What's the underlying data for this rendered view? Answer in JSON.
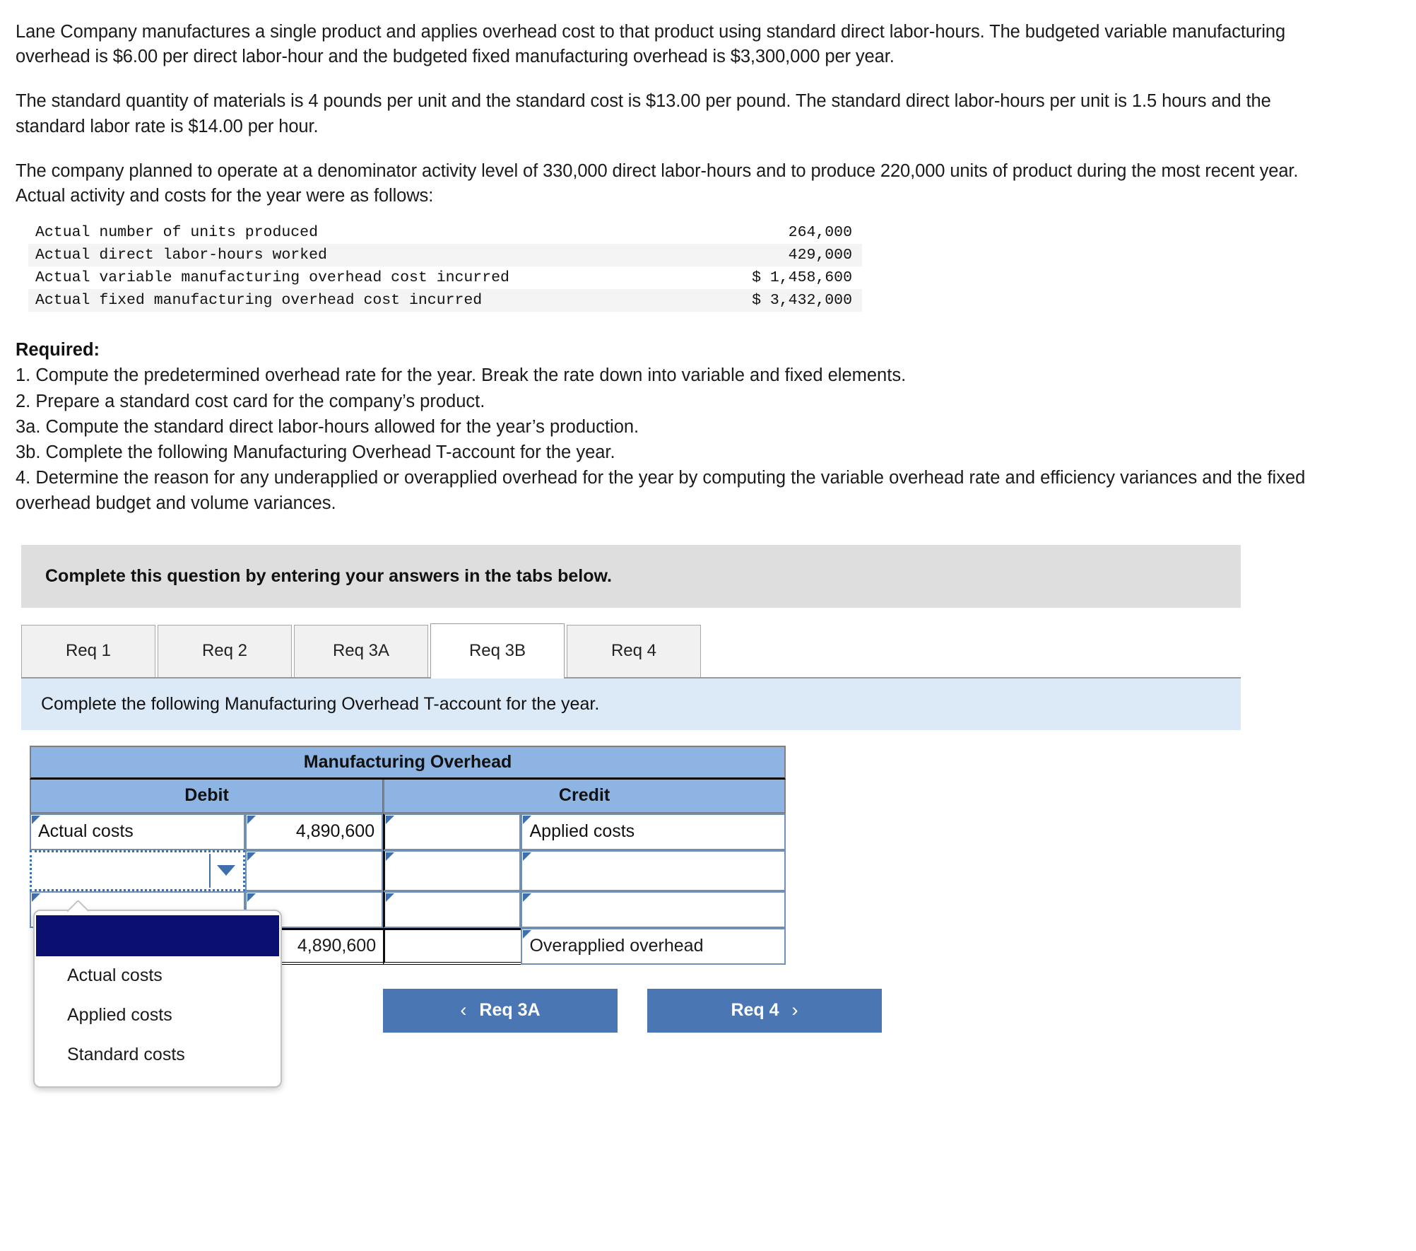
{
  "problem": {
    "paragraphs": [
      "Lane Company manufactures a single product and applies overhead cost to that product using standard direct labor-hours. The budgeted variable manufacturing overhead is $6.00 per direct labor-hour and the budgeted fixed manufacturing overhead is $3,300,000 per year.",
      "The standard quantity of materials is 4 pounds per unit and the standard cost is $13.00 per pound. The standard direct labor-hours per unit is 1.5 hours and the standard labor rate is $14.00 per hour.",
      "The company planned to operate at a denominator activity level of 330,000 direct labor-hours and to produce 220,000 units of product during the most recent year. Actual activity and costs for the year were as follows:"
    ]
  },
  "facts_table": {
    "rows": [
      {
        "label": "Actual number of units produced",
        "value": "264,000"
      },
      {
        "label": "Actual direct labor-hours worked",
        "value": "429,000"
      },
      {
        "label": "Actual variable manufacturing overhead cost incurred",
        "value": "$ 1,458,600"
      },
      {
        "label": "Actual fixed manufacturing overhead cost incurred",
        "value": "$ 3,432,000"
      }
    ]
  },
  "required": {
    "title": "Required:",
    "items": [
      "1. Compute the predetermined overhead rate for the year. Break the rate down into variable and fixed elements.",
      "2. Prepare a standard cost card for the company’s product.",
      "3a. Compute the standard direct labor-hours allowed for the year’s production.",
      "3b. Complete the following Manufacturing Overhead T-account for the year.",
      "4. Determine the reason for any underapplied or overapplied overhead for the year by computing the variable overhead rate and efficiency variances and the fixed overhead budget and volume variances."
    ]
  },
  "banner": {
    "text": "Complete this question by entering your answers in the tabs below."
  },
  "tabs": {
    "items": [
      {
        "label": "Req 1",
        "active": false
      },
      {
        "label": "Req 2",
        "active": false
      },
      {
        "label": "Req 3A",
        "active": false
      },
      {
        "label": "Req 3B",
        "active": true
      },
      {
        "label": "Req 4",
        "active": false
      }
    ]
  },
  "sub_instruction": {
    "text": "Complete the following Manufacturing Overhead T-account for the year."
  },
  "taccount": {
    "title": "Manufacturing Overhead",
    "debit_header": "Debit",
    "credit_header": "Credit",
    "rows": [
      {
        "debit_label": "Actual costs",
        "debit_amount": "4,890,600",
        "credit_amount": "",
        "credit_label": "Applied costs"
      },
      {
        "debit_label": "",
        "debit_amount": "",
        "credit_amount": "",
        "credit_label": ""
      },
      {
        "debit_label": "",
        "debit_amount": "",
        "credit_amount": "",
        "credit_label": ""
      }
    ],
    "total_row": {
      "debit_label": "",
      "debit_amount": "4,890,600",
      "credit_amount": "",
      "credit_label": "Overapplied overhead"
    }
  },
  "dropdown": {
    "selected_value": "",
    "options": [
      "",
      "Actual costs",
      "Applied costs",
      "Standard costs"
    ],
    "option_actual": "Actual costs",
    "option_applied": "Applied costs",
    "option_standard": "Standard costs"
  },
  "nav": {
    "prev_label": "Req 3A",
    "prev_chevron": "‹",
    "next_label": "Req 4",
    "next_chevron": "›"
  },
  "colors": {
    "header_blue": "#8db4e2",
    "cell_border_blue": "#6f8fb5",
    "banner_grey": "#dedede",
    "sub_blue": "#dce9f6",
    "button_blue": "#4a77b4",
    "dropdown_highlight": "#0b1070"
  }
}
